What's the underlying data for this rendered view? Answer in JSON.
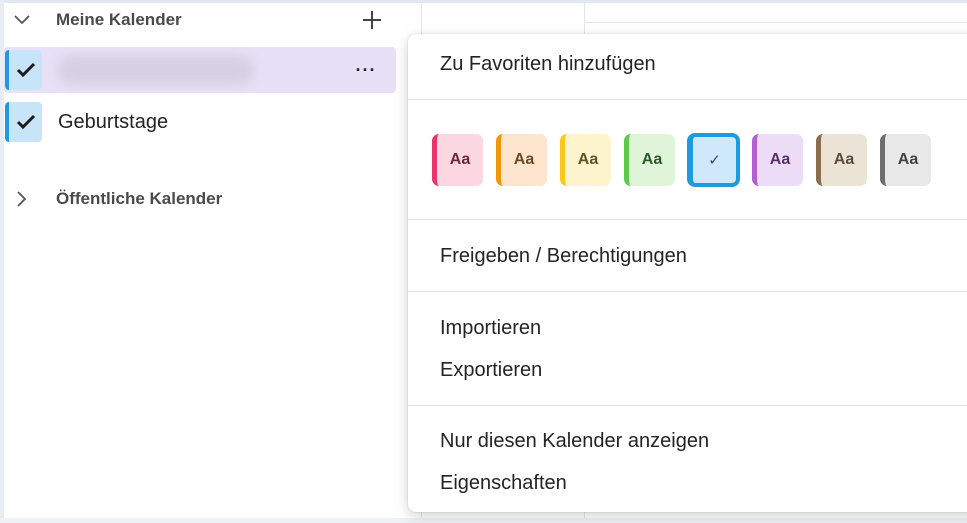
{
  "sidebar": {
    "my_calendars_header": "Meine Kalender",
    "public_calendars_header": "Öffentliche Kalender",
    "items": [
      {
        "label": "",
        "checked": true,
        "selected": true,
        "more_label": "···"
      },
      {
        "label": "Geburtstage",
        "checked": true,
        "selected": false
      }
    ],
    "accent_color": "#1e9ae0",
    "selected_bg": "#e8e0f6"
  },
  "menu": {
    "add_favorites": "Zu Favoriten hinzufügen",
    "share_permissions": "Freigeben / Berechtigungen",
    "import": "Importieren",
    "export": "Exportieren",
    "show_only_this": "Nur diesen Kalender anzeigen",
    "properties": "Eigenschaften",
    "swatches": [
      {
        "text": "Aa",
        "bg": "#fcd6e0",
        "border": "#e8356b",
        "fg": "#6b2a3c",
        "selected": false
      },
      {
        "text": "Aa",
        "bg": "#fde6cd",
        "border": "#f2960c",
        "fg": "#6b4a22",
        "selected": false
      },
      {
        "text": "Aa",
        "bg": "#fdf3cc",
        "border": "#f8c81d",
        "fg": "#5f5422",
        "selected": false
      },
      {
        "text": "Aa",
        "bg": "#dff4d9",
        "border": "#5fc84a",
        "fg": "#2e5a28",
        "selected": false
      },
      {
        "text": "✓",
        "bg": "#cfe8fa",
        "border": "#1e9ae0",
        "fg": "#3a4a5a",
        "selected": true
      },
      {
        "text": "Aa",
        "bg": "#eddcf5",
        "border": "#b05fd6",
        "fg": "#59306b",
        "selected": false
      },
      {
        "text": "Aa",
        "bg": "#ece3d7",
        "border": "#8b6c4f",
        "fg": "#5c4a3a",
        "selected": false
      },
      {
        "text": "Aa",
        "bg": "#e8e8e8",
        "border": "#6e6e6e",
        "fg": "#444444",
        "selected": false
      }
    ]
  }
}
